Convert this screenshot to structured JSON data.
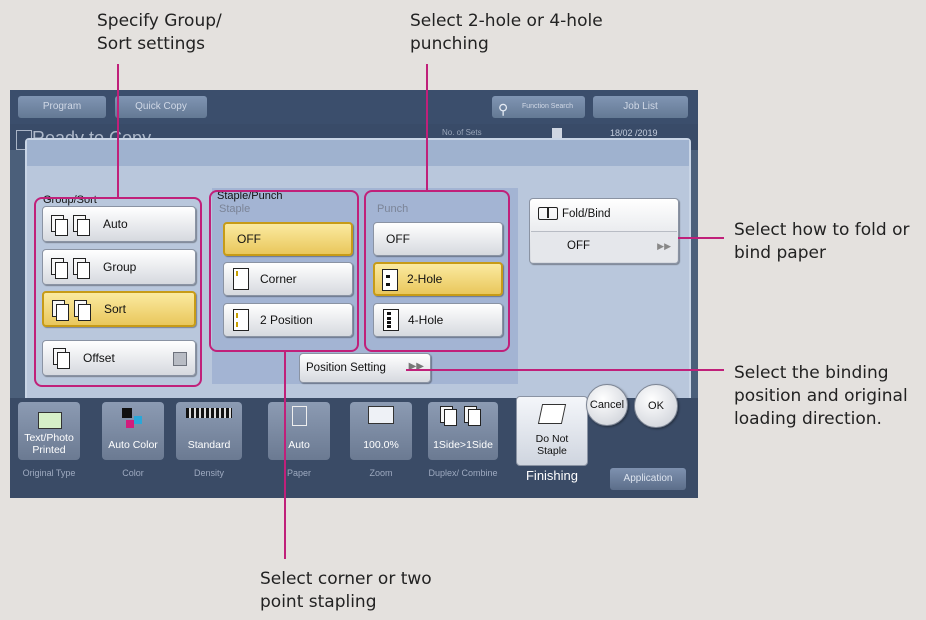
{
  "callouts": {
    "group_sort": [
      "Specify Group/",
      "Sort settings"
    ],
    "punch": [
      "Select 2-hole or 4-hole",
      "punching"
    ],
    "fold": [
      "Select how to fold or",
      "bind paper"
    ],
    "binding": [
      "Select the binding",
      "position and original",
      "loading direction."
    ],
    "staple": [
      "Select corner or two",
      "point stapling"
    ]
  },
  "topbar": {
    "program": "Program",
    "quick_copy": "Quick Copy",
    "function_search": "Function Search",
    "job_list": "Job List",
    "ready": "Ready to Copy",
    "no_of_sets": "No. of Sets",
    "date": "18/02 /2019"
  },
  "dialog": {
    "group_sort": {
      "title": "Group/Sort",
      "options": [
        "Auto",
        "Group",
        "Sort"
      ],
      "selected": "Sort",
      "offset": "Offset"
    },
    "staple_punch": {
      "title": "Staple/Punch",
      "staple_title": "Staple",
      "staple_options": [
        "OFF",
        "Corner",
        "2 Position"
      ],
      "staple_selected": "OFF",
      "punch_title": "Punch",
      "punch_options": [
        "OFF",
        "2-Hole",
        "4-Hole"
      ],
      "punch_selected": "2-Hole",
      "position_setting": "Position Setting"
    },
    "fold_bind": {
      "title": "Fold/Bind",
      "value": "OFF"
    },
    "cancel": "Cancel",
    "ok": "OK"
  },
  "bottom": {
    "tiles": [
      {
        "value": "Text/Photo Printed",
        "category": "Original Type"
      },
      {
        "value": "Auto Color",
        "category": "Color"
      },
      {
        "value": "Standard",
        "category": "Density"
      },
      {
        "value": "Auto",
        "category": "Paper"
      },
      {
        "value": "100.0%",
        "category": "Zoom"
      },
      {
        "value": "1Side>1Side",
        "category": "Duplex/ Combine"
      },
      {
        "value": "Do Not Staple",
        "category": "Finishing"
      }
    ],
    "application": "Application"
  },
  "colors": {
    "callout_line": "#c0207a",
    "selected_button": "#e9c75c",
    "panel_bg": "#4b5f7a",
    "dialog_bg": "#b9c7dc"
  }
}
